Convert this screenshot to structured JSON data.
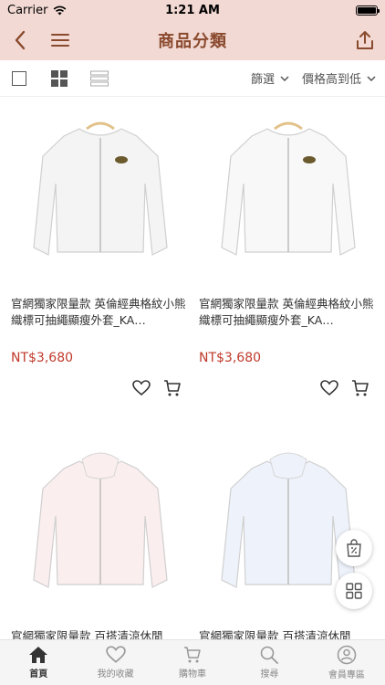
{
  "status": {
    "carrier": "Carrier",
    "time": "1:21 AM"
  },
  "nav": {
    "title": "商品分類"
  },
  "toolbar": {
    "filter_label": "篩選",
    "sort_label": "價格高到低"
  },
  "products": [
    {
      "name": "官網獨家限量款 英倫經典格紋小熊織標可抽繩顯瘦外套_KA…",
      "price": "NT$3,680",
      "tint": "#f4f4f4"
    },
    {
      "name": "官網獨家限量款 英倫經典格紋小熊織標可抽繩顯瘦外套_KA…",
      "price": "NT$3,680",
      "tint": "#f8f8f8"
    },
    {
      "name": "官網獨家限量款 百搭清涼休閒",
      "price": "",
      "tint": "#fbeeee"
    },
    {
      "name": "官網獨家限量款 百搭清涼休閒",
      "price": "",
      "tint": "#eef3fb"
    }
  ],
  "tabs": [
    {
      "label": "首頁",
      "icon": "home-icon",
      "active": true
    },
    {
      "label": "我的收藏",
      "icon": "heart-icon"
    },
    {
      "label": "購物車",
      "icon": "cart-icon"
    },
    {
      "label": "搜尋",
      "icon": "search-icon"
    },
    {
      "label": "會員專區",
      "icon": "user-icon"
    }
  ],
  "colors": {
    "header_bg": "#f2d9d3",
    "title": "#8a4a2e",
    "price": "#c0392b"
  }
}
